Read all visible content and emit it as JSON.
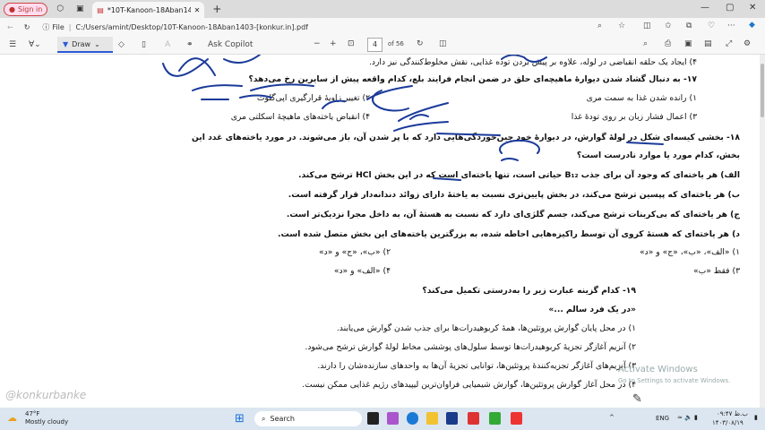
{
  "browser": {
    "signin": "Sign in",
    "tab_title": "*10T-Kanoon-18Aban1403-[konkur.in]",
    "address_prefix": "File",
    "address": "C:/Users/amint/Desktop/10T-Kanoon-18Aban1403-[konkur.in].pdf"
  },
  "pdf_toolbar": {
    "draw": "Draw",
    "ask_copilot": "Ask Copilot",
    "page_current": "4",
    "page_total": "of 56"
  },
  "doc_lines": [
    "۴) ایجاد یک حلقه انقباضی در لوله، علاوه بر پیش بردن توده غذایی، نقش مخلوط‌کنندگی نیز دارد.",
    "۱۷- به دنبال گشاد شدن دیوارهٔ ماهیچه‌ای حلق در ضمن انجام فرایند بلع، کدام واقعه پیش از سایرین رخ می‌دهد؟",
    "۲) تغییر زاویهٔ قرارگیری اپی‌گلوت",
    "۱) رانده شدن غذا به سمت مری",
    "۴) انقباض یاخته‌های ماهیچهٔ اسکلتی مری",
    "۳) اعمال فشار زبان بر روی تودهٔ غذا",
    "۱۸- بخشی کیسه‌ای شکل در لولهٔ گوارش، در دیوارهٔ خود چین‌خوردگی‌هایی دارد که با پر شدن آن، باز می‌شوند. در مورد یاخته‌های غدد این",
    "بخش، کدام مورد یا موارد نادرست است؟",
    "الف) هر یاخته‌ای که وجود آن برای جذب B₁₂ حیاتی است، تنها یاخته‌ای است که در این بخش HCl ترشح می‌کند.",
    "ب) هر یاخته‌ای که پپسین ترشح می‌کند، در بخش پایین‌تری نسبت به یاختهٔ دارای زوائد دندانه‌دار قرار گرفته است.",
    "ج) هر یاخته‌ای که بی‌کربنات ترشح می‌کند، جسم گلژی‌ای دارد که نسبت به هستهٔ آن، به داخل مجرا نزدیک‌تر است.",
    "د) هر یاخته‌ای که هستهٔ کروی آن توسط راکیزه‌هایی احاطه شده، به بزرگترین یاخته‌های این بخش متصل شده است.",
    "۱) «الف»، «ب»، «ج» و «د»",
    "۲) «ب»، «ج» و «د»",
    "۳) فقط «ب»",
    "۴) «الف» و «د»",
    "۱۹- کدام گزینه عبارت زیر را به‌درستی تکمیل می‌کند؟",
    "«در یک فرد سالم ...»",
    "۱) در محل پایان گوارش پروتئین‌ها، همهٔ کربوهیدرات‌ها برای جذب شدن گوارش می‌یابند.",
    "۲) آنزیم آغازگر تجزیهٔ کربوهیدرات‌ها توسط سلول‌های پوششی مخاط لولهٔ گوارش ترشح می‌شود.",
    "۳) آنزیم‌های آغازگر تجزیه‌کنندهٔ پروتئین‌ها، توانایی تجزیهٔ آن‌ها به واحدهای سازنده‌شان را دارند.",
    "۴) در محل آغاز گوارش پروتئین‌ها، گوارش شیمیایی فراوان‌ترین لیپیدهای رژیم غذایی ممکن نیست."
  ],
  "overlay": {
    "activate_title": "Activate Windows",
    "activate_sub": "Go to Settings to activate Windows.",
    "watermark": "@konkurbanke"
  },
  "taskbar": {
    "temp": "47°F",
    "weather": "Mostly cloudy",
    "search": "Search",
    "lang": "ENG",
    "time": "۰۹:۴۷ ب.ظ",
    "date": "۱۴۰۳/۰۸/۱۹"
  }
}
